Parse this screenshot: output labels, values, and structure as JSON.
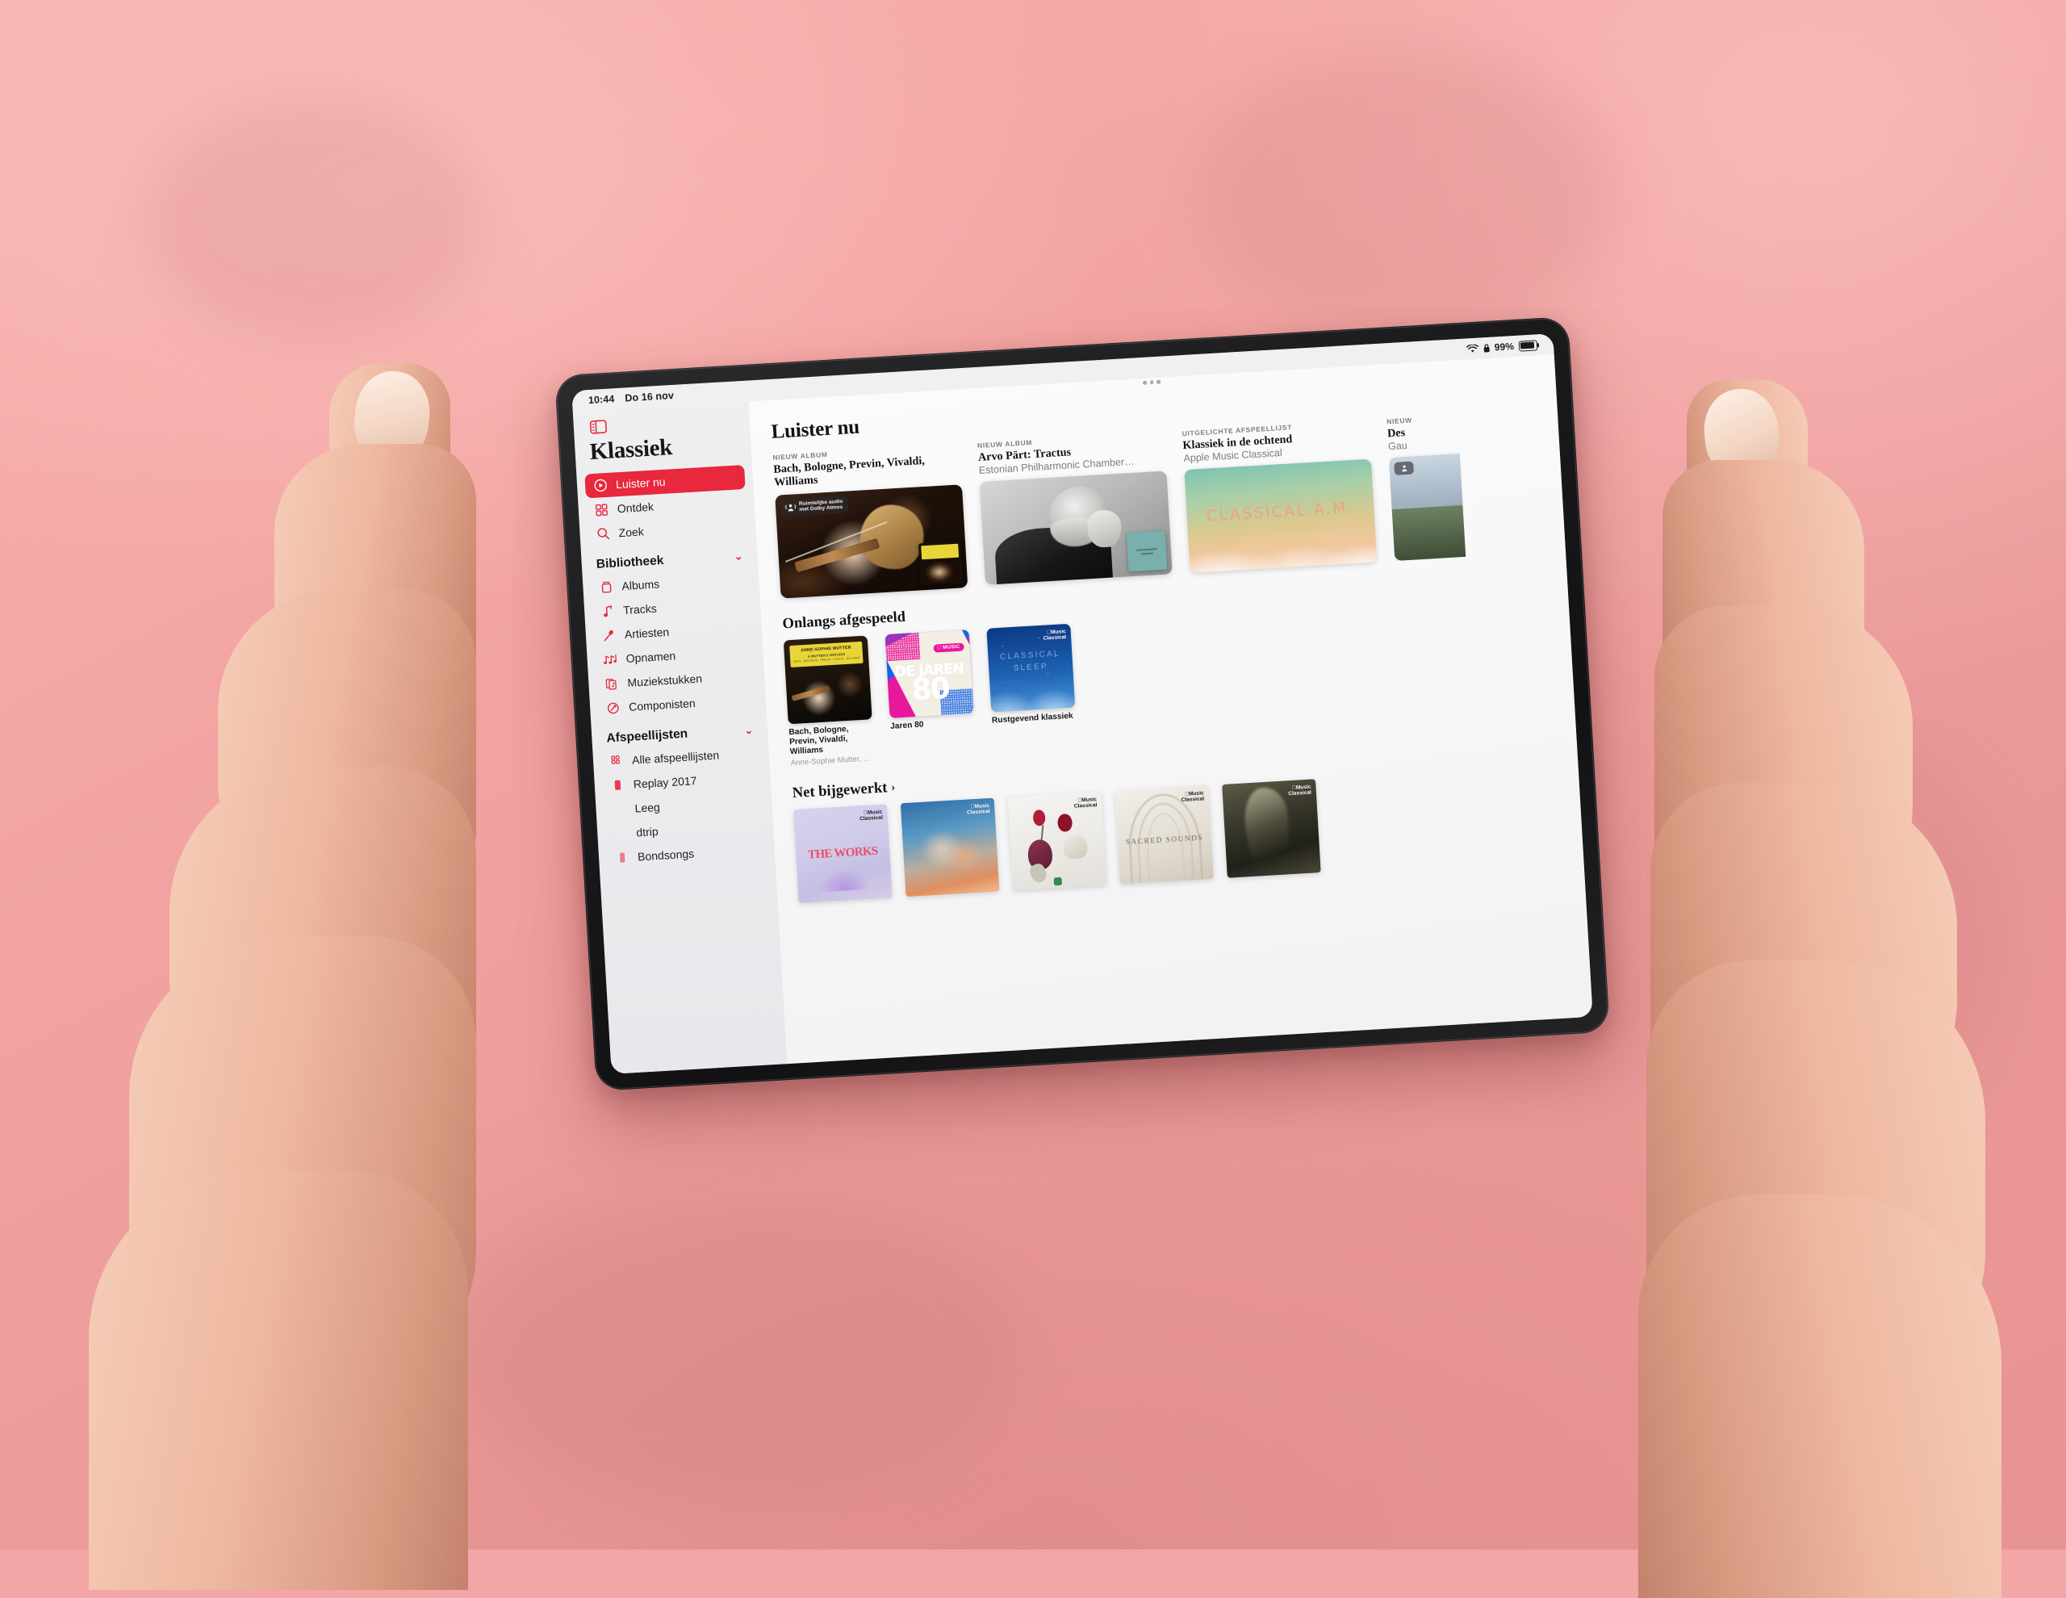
{
  "device": {
    "status_bar": {
      "time": "10:44",
      "date": "Do 16 nov",
      "wifi_icon": "wifi-icon",
      "lock_icon": "lock-icon",
      "battery_percent": "99%"
    },
    "multitask_dots": "multitasking-indicator"
  },
  "sidebar": {
    "toggle_icon": "sidebar-toggle-icon",
    "app_title": "Klassiek",
    "primary": [
      {
        "label": "Luister nu",
        "icon": "play-circle-icon",
        "active": true
      },
      {
        "label": "Ontdek",
        "icon": "grid-icon",
        "active": false
      },
      {
        "label": "Zoek",
        "icon": "search-icon",
        "active": false
      }
    ],
    "library": {
      "header": "Bibliotheek",
      "chevron": "⌄",
      "items": [
        {
          "label": "Albums",
          "icon": "album-icon"
        },
        {
          "label": "Tracks",
          "icon": "music-note-icon"
        },
        {
          "label": "Artiesten",
          "icon": "microphone-icon"
        },
        {
          "label": "Opnamen",
          "icon": "double-note-icon"
        },
        {
          "label": "Muziekstukken",
          "icon": "sheet-music-icon"
        },
        {
          "label": "Componisten",
          "icon": "composer-icon"
        }
      ]
    },
    "playlists": {
      "header": "Afspeellijsten",
      "chevron": "⌄",
      "items": [
        {
          "label": "Alle afspeellijsten",
          "icon": "playlist-grid-icon"
        },
        {
          "label": "Replay 2017",
          "icon": "playlist-icon"
        },
        {
          "label": "Leeg",
          "icon": "playlist-icon"
        },
        {
          "label": "dtrip",
          "icon": "playlist-icon"
        },
        {
          "label": "Bondsongs",
          "icon": "playlist-icon"
        }
      ]
    }
  },
  "main": {
    "page_title": "Luister nu",
    "featured": [
      {
        "kicker": "NIEUW ALBUM",
        "title": "Bach, Bologne, Previn, Vivaldi, Williams",
        "subtitle": "",
        "artwork": "anne-sophie-mutter-violin",
        "badge": {
          "line1": "Ruimtelijke audio",
          "line2": "met Dolby Atmos"
        }
      },
      {
        "kicker": "NIEUW ALBUM",
        "title": "Arvo Pärt: Tractus",
        "subtitle": "Estonian Philharmonic Chamber…",
        "artwork": "arvo-part-portrait"
      },
      {
        "kicker": "UITGELICHTE AFSPEELLIJST",
        "title": "Klassiek in de ochtend",
        "subtitle": "Apple Music Classical",
        "artwork": "classical-am-sky",
        "artwork_text": "CLASSICAL A.M."
      },
      {
        "kicker": "NIEUW",
        "title": "Des",
        "subtitle": "Gau",
        "artwork": "cityscape-partial"
      }
    ],
    "recently_played": {
      "header": "Onlangs afgespeeld",
      "items": [
        {
          "title": "Bach, Bologne, Previn, Vivaldi, Williams",
          "subtitle": "Anne-Sophie Mutter, Mutte…",
          "artwork": "dg-mutter-album",
          "artwork_text_1": "ANNE-SOPHIE MUTTER",
          "artwork_text_2": "& MUTTER'S VIRTUOSI",
          "artwork_text_3": "BACH · BOLOGNE · PREVIN · VIVALDI · WILLIAMS"
        },
        {
          "title": "Jaren 80",
          "subtitle": "",
          "artwork": "de-jaren-80",
          "artwork_text_1": "DE JAREN",
          "artwork_text_2": "80",
          "artwork_tag": "MUSIC"
        },
        {
          "title": "Rustgevend klassiek",
          "subtitle": "",
          "artwork": "classical-sleep",
          "artwork_text_1": "CLASSICAL",
          "artwork_text_2": "SLEEP",
          "badge_line1": "Music",
          "badge_line2": "Classical"
        }
      ]
    },
    "just_updated": {
      "header": "Net bijgewerkt",
      "arrow": "›",
      "items": [
        {
          "title": "THE WORKS",
          "artwork": "the-works",
          "badge_line1": "Music",
          "badge_line2": "Classical"
        },
        {
          "title": "",
          "artwork": "sky-clouds",
          "badge_line1": "Music",
          "badge_line2": "Classical"
        },
        {
          "title": "",
          "artwork": "glass-flowers",
          "badge_line1": "Music",
          "badge_line2": "Classical"
        },
        {
          "title": "SACRED SOUNDS",
          "artwork": "sacred-sounds",
          "badge_line1": "Music",
          "badge_line2": "Classical"
        },
        {
          "title": "",
          "artwork": "dark-abstract",
          "badge_line1": "Music",
          "badge_line2": "Classical"
        }
      ]
    }
  },
  "colors": {
    "accent_red": "#e8283c",
    "background_pink": "#f3a6a6",
    "sidebar_bg": "#ecedef",
    "text_primary": "#131316",
    "text_secondary": "#7d7d84"
  }
}
